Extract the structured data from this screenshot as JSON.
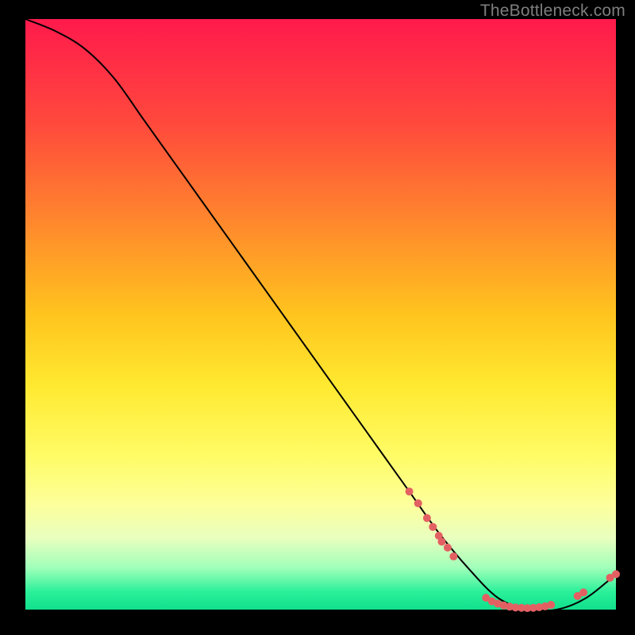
{
  "watermark": "TheBottleneck.com",
  "chart_data": {
    "type": "line",
    "title": "",
    "xlabel": "",
    "ylabel": "",
    "xlim": [
      0,
      100
    ],
    "ylim": [
      0,
      100
    ],
    "grid": false,
    "series": [
      {
        "name": "bottleneck-curve",
        "x": [
          0,
          5,
          10,
          15,
          20,
          25,
          30,
          35,
          40,
          45,
          50,
          55,
          60,
          65,
          70,
          75,
          80,
          85,
          90,
          95,
          100
        ],
        "y": [
          100,
          98,
          95,
          90,
          83,
          76,
          69,
          62,
          55,
          48,
          41,
          34,
          27,
          20,
          13,
          7,
          2,
          0,
          0,
          2,
          6
        ],
        "stroke": "#000000",
        "width": 2
      }
    ],
    "markers": {
      "name": "sample-points",
      "color": "#e36062",
      "radius": 5,
      "points": [
        {
          "x": 65,
          "y": 20
        },
        {
          "x": 66.5,
          "y": 18
        },
        {
          "x": 68,
          "y": 15.5
        },
        {
          "x": 69,
          "y": 14
        },
        {
          "x": 70,
          "y": 12.5
        },
        {
          "x": 70.5,
          "y": 11.5
        },
        {
          "x": 71.5,
          "y": 10.5
        },
        {
          "x": 72.5,
          "y": 9
        },
        {
          "x": 78,
          "y": 2.0
        },
        {
          "x": 79,
          "y": 1.4
        },
        {
          "x": 80,
          "y": 1.0
        },
        {
          "x": 81,
          "y": 0.7
        },
        {
          "x": 82,
          "y": 0.5
        },
        {
          "x": 83,
          "y": 0.35
        },
        {
          "x": 84,
          "y": 0.3
        },
        {
          "x": 85,
          "y": 0.25
        },
        {
          "x": 86,
          "y": 0.3
        },
        {
          "x": 87,
          "y": 0.4
        },
        {
          "x": 88,
          "y": 0.55
        },
        {
          "x": 89,
          "y": 0.8
        },
        {
          "x": 93.5,
          "y": 2.3
        },
        {
          "x": 94.5,
          "y": 2.9
        },
        {
          "x": 99,
          "y": 5.4
        },
        {
          "x": 100,
          "y": 6.0
        }
      ]
    }
  }
}
